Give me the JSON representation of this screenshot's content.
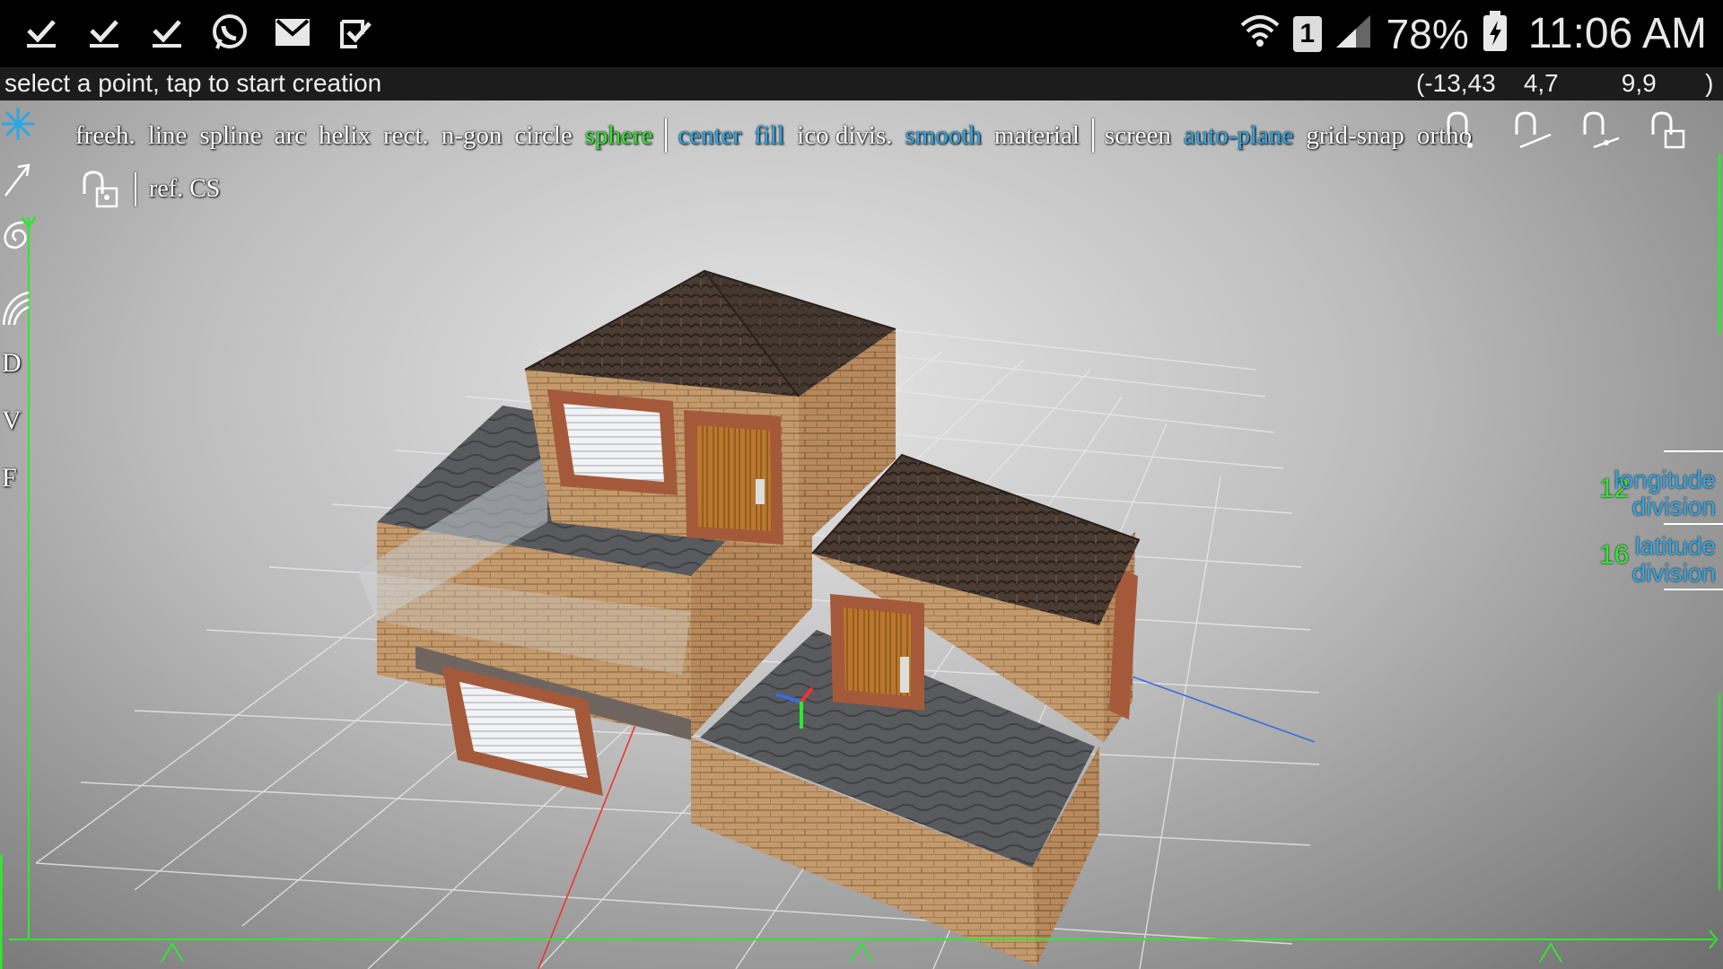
{
  "status_bar": {
    "left_icons": [
      "check-icon",
      "check-icon",
      "check-icon",
      "whatsapp-icon",
      "gmail-icon",
      "tasks-icon"
    ],
    "sim_label": "1",
    "battery_percent": "78%",
    "time": "11:06 AM"
  },
  "info": {
    "message": "select a point, tap to start creation",
    "coords": "(-13,43    4,7         9,9       )"
  },
  "toolbar": {
    "items": [
      "freeh.",
      "line",
      "spline",
      "arc",
      "helix",
      "rect.",
      "n-gon",
      "circle",
      "sphere"
    ],
    "options": [
      "center",
      "fill",
      "ico divis.",
      "smooth",
      "material"
    ],
    "planes": [
      "screen",
      "auto-plane",
      "grid-snap",
      "ortho"
    ],
    "ref_cs": "ref. CS"
  },
  "left_tools": [
    "D",
    "V",
    "F"
  ],
  "side_panel": {
    "longitude_value": "12",
    "longitude_label_1": "longitude",
    "longitude_label_2": "division",
    "latitude_value": "16",
    "latitude_label_1": "latitude",
    "latitude_label_2": "division"
  },
  "colors": {
    "accent_green": "#2ee82e",
    "accent_blue": "#2ba7e8"
  }
}
